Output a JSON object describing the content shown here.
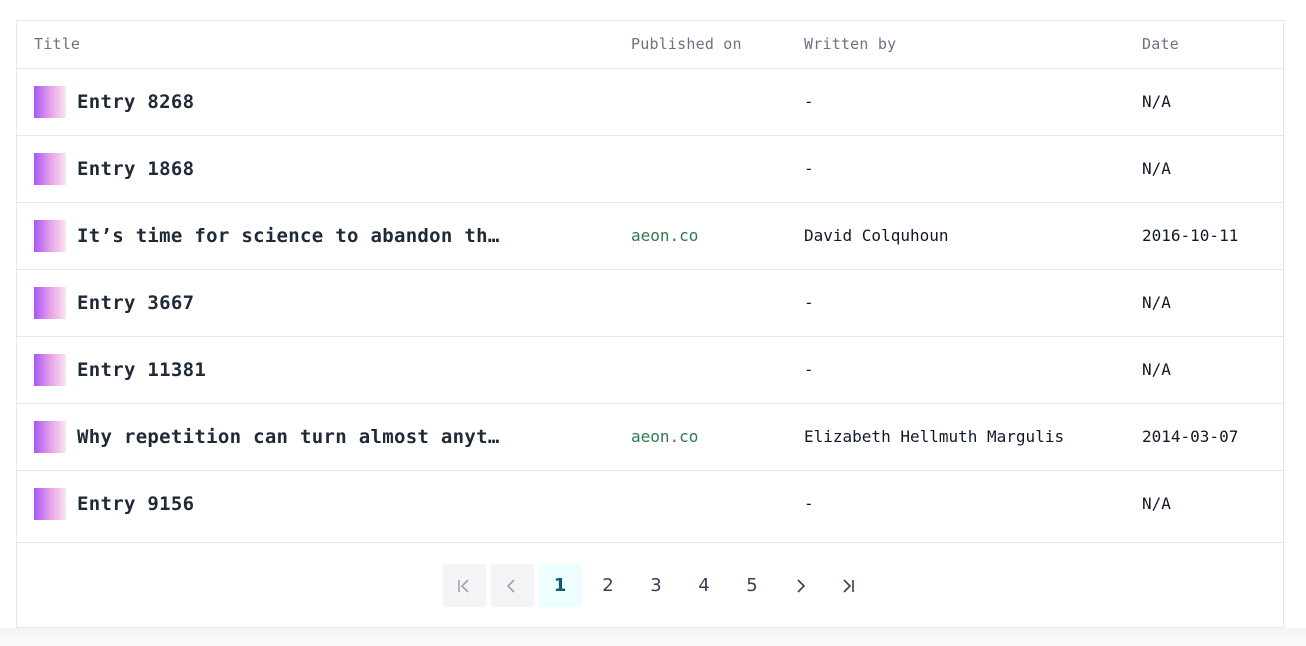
{
  "table": {
    "headers": {
      "title": "Title",
      "published_on": "Published on",
      "written_by": "Written by",
      "date": "Date"
    },
    "rows": [
      {
        "title": "Entry 8268",
        "published_on": "",
        "written_by": "-",
        "date": "N/A"
      },
      {
        "title": "Entry 1868",
        "published_on": "",
        "written_by": "-",
        "date": "N/A"
      },
      {
        "title": "It’s time for science to abandon the …",
        "published_on": "aeon.co",
        "written_by": "David Colquhoun",
        "date": "2016-10-11"
      },
      {
        "title": "Entry 3667",
        "published_on": "",
        "written_by": "-",
        "date": "N/A"
      },
      {
        "title": "Entry 11381",
        "published_on": "",
        "written_by": "-",
        "date": "N/A"
      },
      {
        "title": "Why repetition can turn almost anythi…",
        "published_on": "aeon.co",
        "written_by": "Elizabeth Hellmuth Margulis",
        "date": "2014-03-07"
      },
      {
        "title": "Entry 9156",
        "published_on": "",
        "written_by": "-",
        "date": "N/A"
      }
    ]
  },
  "pagination": {
    "first_icon": "first-page-icon",
    "prev_icon": "chevron-left-icon",
    "pages": [
      "1",
      "2",
      "3",
      "4",
      "5"
    ],
    "current_page": "1",
    "next_icon": "chevron-right-icon",
    "last_icon": "last-page-icon"
  },
  "colors": {
    "link": "#2f7a4f",
    "active_page_bg": "#ecfeff",
    "thumb_gradient_start": "#a855f7",
    "thumb_gradient_end": "#fbe4f1"
  }
}
